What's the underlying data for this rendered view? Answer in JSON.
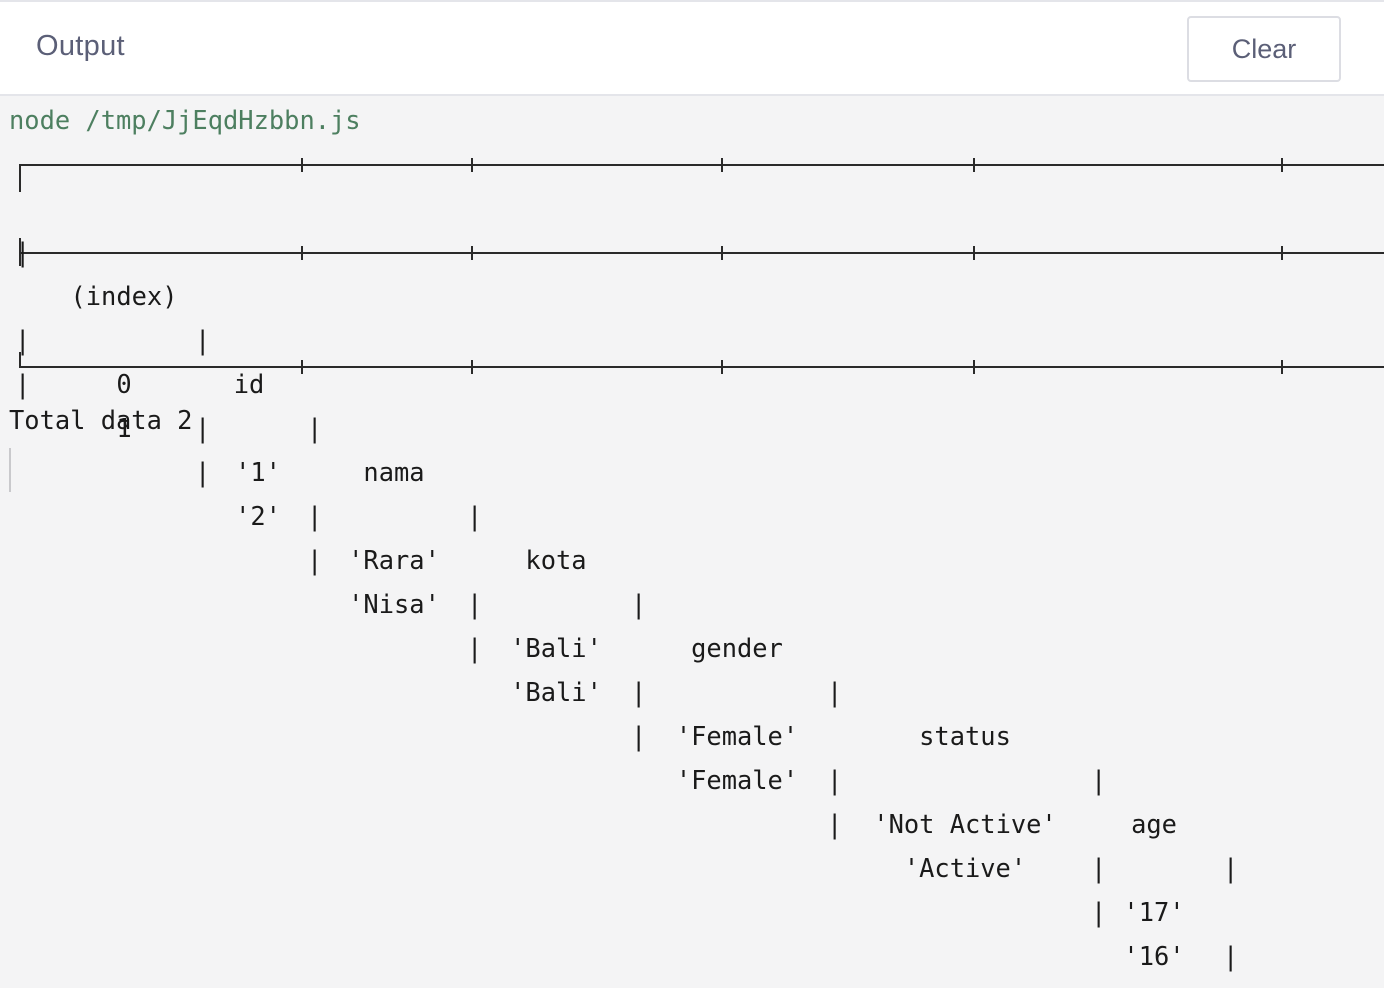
{
  "panel": {
    "title": "Output",
    "clear_label": "Clear"
  },
  "console": {
    "command": "node /tmp/JjEqdHzbbn.js",
    "total_line": "Total data 2"
  },
  "table": {
    "headers": [
      "(index)",
      "id",
      "nama",
      "kota",
      "gender",
      "status",
      "age"
    ],
    "rows": [
      [
        "0",
        "'1'",
        "'Rara'",
        "'Bali'",
        "'Female'",
        "'Not Active'",
        "'17'"
      ],
      [
        "1",
        "'2'",
        "'Nisa'",
        "'Bali'",
        "'Female'",
        "'Active'",
        "'16'"
      ]
    ]
  }
}
